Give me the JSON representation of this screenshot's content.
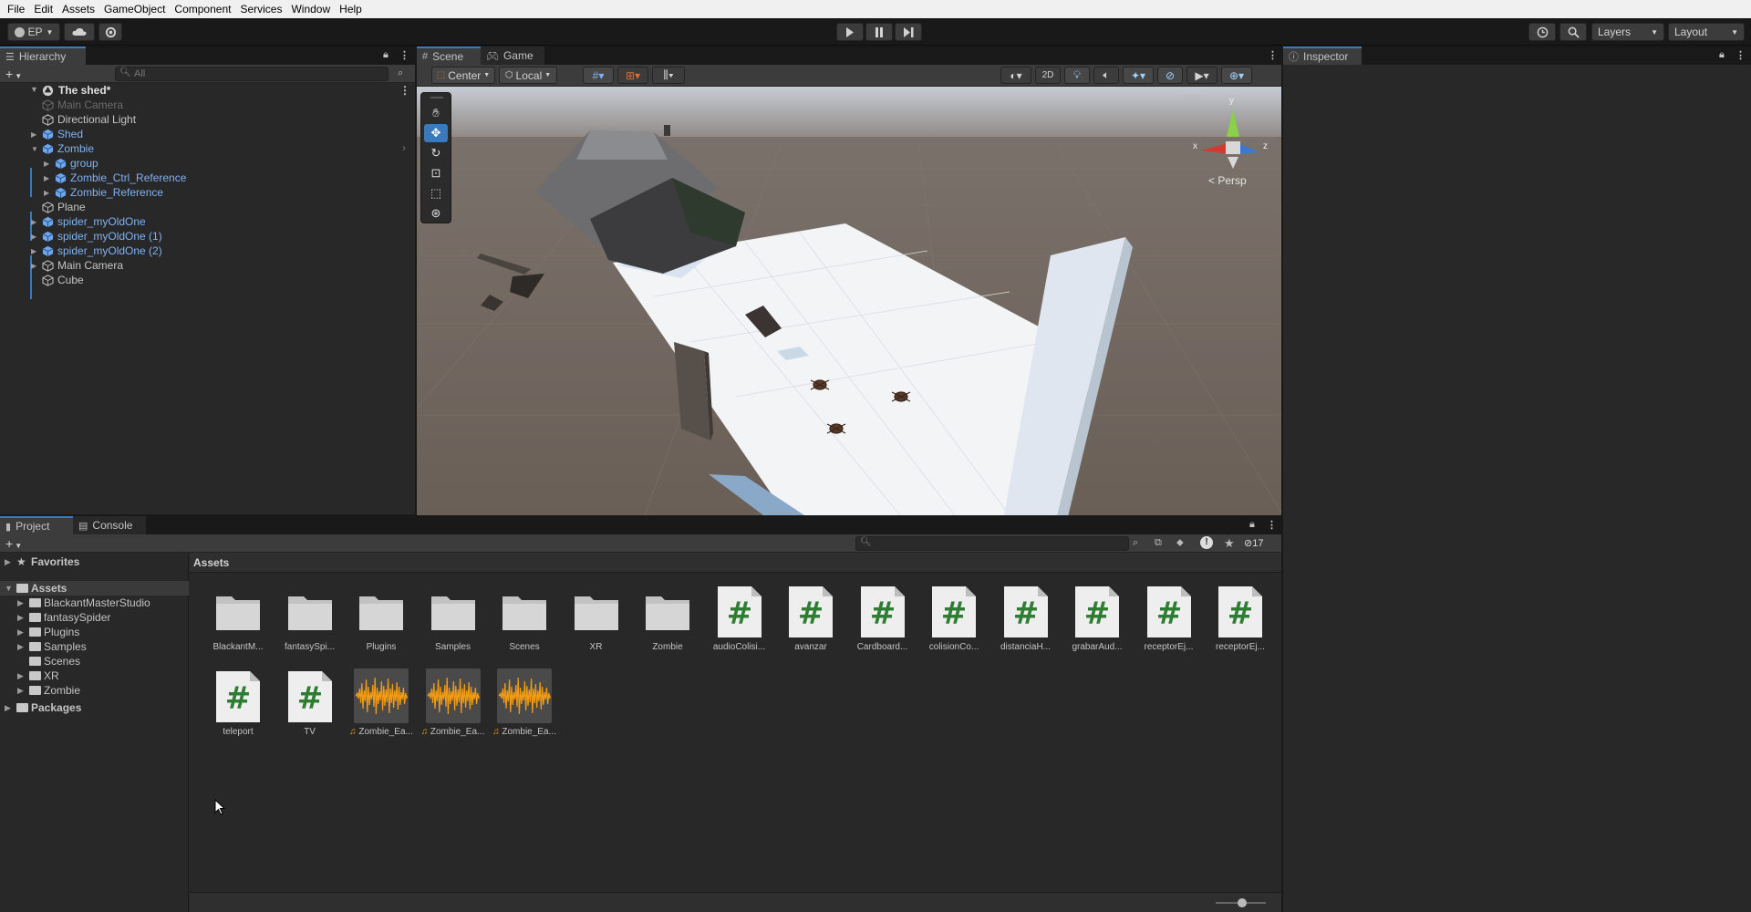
{
  "menu": [
    "File",
    "Edit",
    "Assets",
    "GameObject",
    "Component",
    "Services",
    "Window",
    "Help"
  ],
  "toolbar": {
    "account": "EP",
    "layers": "Layers",
    "layout": "Layout"
  },
  "hierarchy": {
    "tab": "Hierarchy",
    "search_placeholder": "All",
    "scene_name": "The shed*",
    "items": [
      {
        "label": "Main Camera",
        "style": "dim"
      },
      {
        "label": "Directional Light",
        "style": "normal"
      },
      {
        "label": "Shed",
        "style": "prefab"
      },
      {
        "label": "Zombie",
        "style": "prefab"
      },
      {
        "label": "group",
        "style": "prefab"
      },
      {
        "label": "Zombie_Ctrl_Reference",
        "style": "prefab"
      },
      {
        "label": "Zombie_Reference",
        "style": "prefab"
      },
      {
        "label": "Plane",
        "style": "normal"
      },
      {
        "label": "spider_myOldOne",
        "style": "prefab"
      },
      {
        "label": "spider_myOldOne (1)",
        "style": "prefab"
      },
      {
        "label": "spider_myOldOne (2)",
        "style": "prefab"
      },
      {
        "label": "Main Camera",
        "style": "normal"
      },
      {
        "label": "Cube",
        "style": "normal"
      }
    ]
  },
  "scene": {
    "tabs": [
      "Scene",
      "Game"
    ],
    "pivot": "Center",
    "space": "Local",
    "mode_2d": "2D",
    "persp": "Persp",
    "axis_labels": {
      "y": "y",
      "x": "x",
      "z": "z"
    }
  },
  "inspector": {
    "tab": "Inspector"
  },
  "project": {
    "tabs": [
      "Project",
      "Console"
    ],
    "breadcrumb": "Assets",
    "hidden_count": "17",
    "favorites": "Favorites",
    "tree_root": "Assets",
    "tree_children": [
      "BlackantMasterStudio",
      "fantasySpider",
      "Plugins",
      "Samples",
      "Scenes",
      "XR",
      "Zombie"
    ],
    "packages": "Packages",
    "assets_row1": [
      {
        "type": "folder",
        "label": "BlackantM..."
      },
      {
        "type": "folder",
        "label": "fantasySpi..."
      },
      {
        "type": "folder",
        "label": "Plugins"
      },
      {
        "type": "folder",
        "label": "Samples"
      },
      {
        "type": "folder",
        "label": "Scenes"
      },
      {
        "type": "folder",
        "label": "XR"
      },
      {
        "type": "folder",
        "label": "Zombie"
      },
      {
        "type": "script",
        "label": "audioColisi..."
      },
      {
        "type": "script",
        "label": "avanzar"
      },
      {
        "type": "script",
        "label": "Cardboard..."
      },
      {
        "type": "script",
        "label": "colisionCo..."
      },
      {
        "type": "script",
        "label": "distanciaH..."
      },
      {
        "type": "script",
        "label": "grabarAud..."
      },
      {
        "type": "script",
        "label": "receptorEj..."
      },
      {
        "type": "script",
        "label": "receptorEj..."
      }
    ],
    "assets_row2": [
      {
        "type": "script",
        "label": "teleport"
      },
      {
        "type": "script",
        "label": "TV"
      },
      {
        "type": "audio",
        "label": "Zombie_Ea..."
      },
      {
        "type": "audio",
        "label": "Zombie_Ea..."
      },
      {
        "type": "audio",
        "label": "Zombie_Ea..."
      }
    ]
  },
  "colors": {
    "accent": "#3a79bb",
    "prefab_text": "#7fb2f2",
    "script_hash": "#2e7d32",
    "audio_wave": "#f39c12"
  }
}
